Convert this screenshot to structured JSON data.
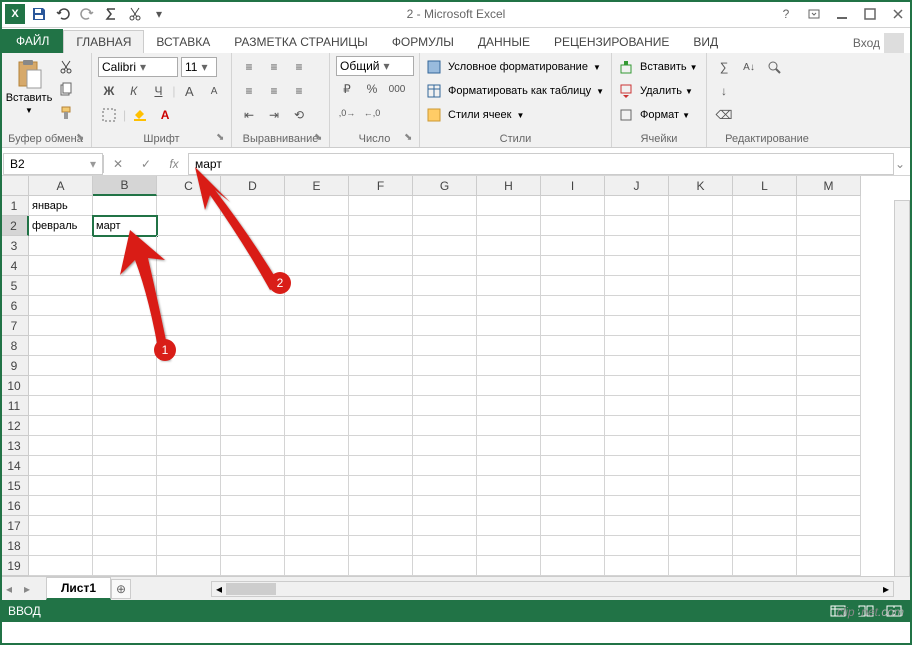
{
  "title": "2 - Microsoft Excel",
  "login": "Вход",
  "tabs": {
    "file": "ФАЙЛ",
    "home": "ГЛАВНАЯ",
    "insert": "ВСТАВКА",
    "layout": "РАЗМЕТКА СТРАНИЦЫ",
    "formulas": "ФОРМУЛЫ",
    "data": "ДАННЫЕ",
    "review": "РЕЦЕНЗИРОВАНИЕ",
    "view": "ВИД"
  },
  "ribbon": {
    "clipboard": {
      "label": "Буфер обмена",
      "paste": "Вставить"
    },
    "font": {
      "label": "Шрифт",
      "name": "Calibri",
      "size": "11",
      "bold": "Ж",
      "italic": "К",
      "underline": "Ч"
    },
    "align": {
      "label": "Выравнивание"
    },
    "number": {
      "label": "Число",
      "format": "Общий"
    },
    "styles": {
      "label": "Стили",
      "cond": "Условное форматирование",
      "table": "Форматировать как таблицу",
      "cell": "Стили ячеек"
    },
    "cells": {
      "label": "Ячейки",
      "insert": "Вставить",
      "delete": "Удалить",
      "format": "Формат"
    },
    "editing": {
      "label": "Редактирование"
    }
  },
  "namebox": "B2",
  "formula": "март",
  "columns": [
    "A",
    "B",
    "C",
    "D",
    "E",
    "F",
    "G",
    "H",
    "I",
    "J",
    "K",
    "L",
    "M"
  ],
  "rows": [
    "1",
    "2",
    "3",
    "4",
    "5",
    "6",
    "7",
    "8",
    "9",
    "10",
    "11",
    "12",
    "13",
    "14",
    "15",
    "16",
    "17",
    "18",
    "19"
  ],
  "cells": {
    "A1": "январь",
    "A2": "февраль",
    "B2": "март"
  },
  "activeCell": "B2",
  "sheet": {
    "tab": "Лист1"
  },
  "status": "ВВОД",
  "annotation": {
    "1": "1",
    "2": "2"
  },
  "watermark": {
    "t1": "clip",
    "t2": "2",
    "t3": "net",
    "t4": ".com"
  }
}
